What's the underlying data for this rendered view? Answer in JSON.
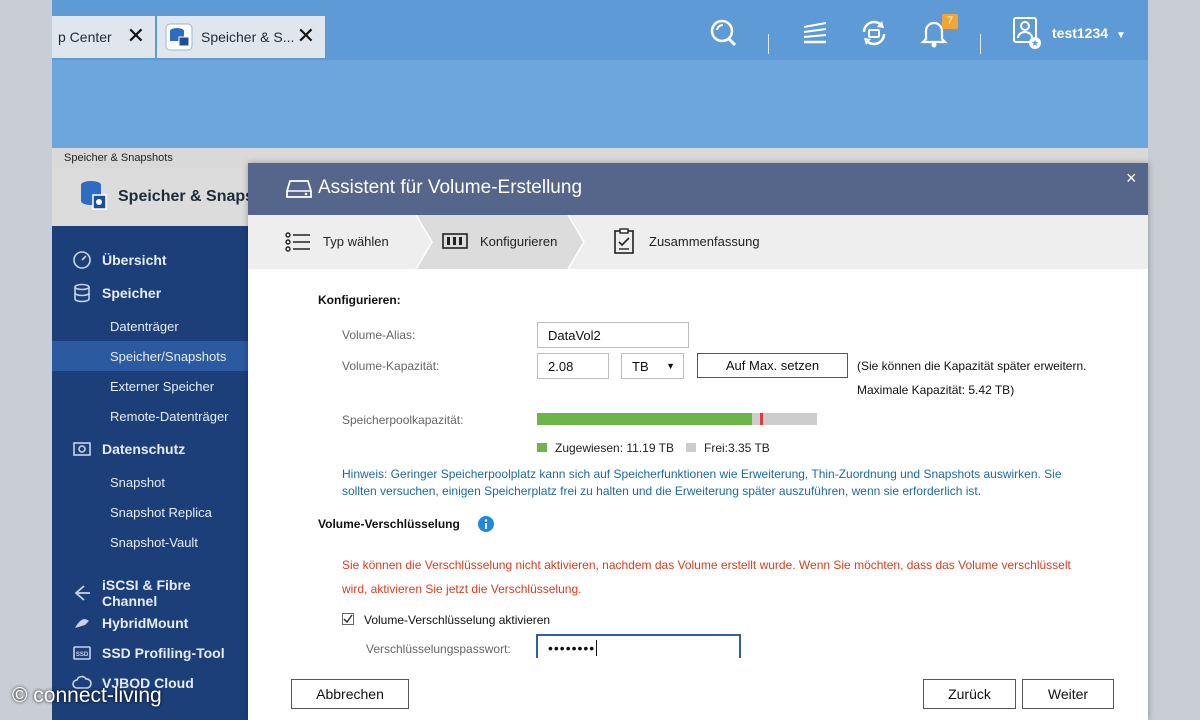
{
  "tabs": [
    {
      "label": "p Center",
      "close": "✕"
    },
    {
      "label": "Speicher & S...",
      "close": "✕"
    }
  ],
  "topbar": {
    "notifications_count": "7",
    "user_name": "test1234"
  },
  "breadcrumb": "Speicher & Snapshots",
  "app": {
    "title": "Speicher & Snapsh"
  },
  "nav": [
    {
      "label": "Übersicht",
      "icon": "dashboard-icon",
      "kind": "section"
    },
    {
      "label": "Speicher",
      "icon": "database-icon",
      "kind": "section"
    },
    {
      "label": "Datenträger",
      "kind": "sub"
    },
    {
      "label": "Speicher/Snapshots",
      "kind": "sub",
      "active": true
    },
    {
      "label": "Externer Speicher",
      "kind": "sub"
    },
    {
      "label": "Remote-Datenträger",
      "kind": "sub"
    },
    {
      "label": "Datenschutz",
      "icon": "camera-icon",
      "kind": "section"
    },
    {
      "label": "Snapshot",
      "kind": "sub"
    },
    {
      "label": "Snapshot Replica",
      "kind": "sub"
    },
    {
      "label": "Snapshot-Vault",
      "kind": "sub"
    },
    {
      "label": "iSCSI & Fibre Channel",
      "icon": "iscsi-icon",
      "kind": "section"
    },
    {
      "label": "HybridMount",
      "icon": "hybridmount-icon",
      "kind": "section"
    },
    {
      "label": "SSD Profiling-Tool",
      "icon": "ssd-icon",
      "kind": "section"
    },
    {
      "label": "VJBOD Cloud",
      "icon": "cloud-icon",
      "kind": "section"
    }
  ],
  "watermark": "© connect-living",
  "dialog": {
    "title": "Assistent für Volume-Erstellung",
    "close": "×",
    "steps": [
      "Typ wählen",
      "Konfigurieren",
      "Zusammenfassung"
    ],
    "section_title": "Konfigurieren:",
    "alias_label": "Volume-Alias:",
    "alias_value": "DataVol2",
    "capacity_label": "Volume-Kapazität:",
    "capacity_value": "2.08",
    "capacity_unit": "TB",
    "max_button": "Auf Max. setzen",
    "capacity_note": "(Sie können die Kapazität später erweitern.",
    "max_capacity": "Maximale Kapazität: 5.42 TB)",
    "pool_label": "Speicherpoolkapazität:",
    "pool_allocated_fraction": 0.768,
    "pool_new_fraction": 0.011,
    "legend_allocated": "Zugewiesen:  11.19 TB",
    "legend_free": "Frei:3.35 TB",
    "hint_line1": "Hinweis: Geringer Speicherpoolplatz kann sich auf Speicherfunktionen wie Erweiterung, Thin-Zuordnung und Snapshots auswirken. Sie",
    "hint_line2": "sollten versuchen, einigen Speicherplatz frei zu halten und die Erweiterung später auszuführen, wenn sie erforderlich ist.",
    "encryption_title": "Volume-Verschlüsselung",
    "warn_line1": "Sie können die Verschlüsselung nicht aktivieren, nachdem das Volume erstellt wurde. Wenn Sie möchten, dass das Volume verschlüsselt",
    "warn_line2": "wird, aktivieren Sie jetzt die Verschlüsselung.",
    "checkbox_label": "Volume-Verschlüsselung aktivieren",
    "password_label": "Verschlüsselungspasswort:",
    "password_value": "••••••••",
    "cancel": "Abbrechen",
    "back": "Zurück",
    "next": "Weiter"
  },
  "colors": {
    "allocated": "#6cb548",
    "new": "#e53935",
    "free": "#cccccc",
    "header": "#56658a",
    "nav": "#1c3f7a"
  }
}
